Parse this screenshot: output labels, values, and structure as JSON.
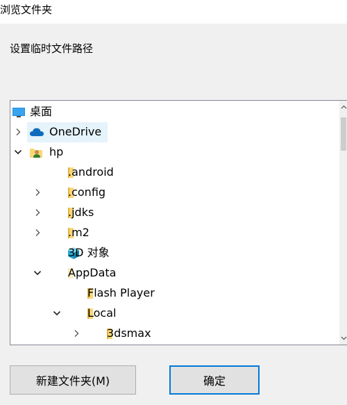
{
  "window": {
    "title": "浏览文件夹"
  },
  "instruction": "设置临时文件路径",
  "tree": {
    "items": [
      {
        "label": "桌面",
        "icon": "desktop-icon",
        "toggle": "none",
        "level": 0
      },
      {
        "label": "OneDrive",
        "icon": "cloud-icon",
        "toggle": "collapsed",
        "level": 0,
        "hover": true
      },
      {
        "label": "hp",
        "icon": "user-folder-icon",
        "toggle": "expanded",
        "level": 0
      },
      {
        "label": ".android",
        "icon": "folder-icon",
        "toggle": "none",
        "level": 1
      },
      {
        "label": ".config",
        "icon": "folder-icon",
        "toggle": "collapsed",
        "level": 1
      },
      {
        "label": ".jdks",
        "icon": "folder-icon",
        "toggle": "collapsed",
        "level": 1
      },
      {
        "label": ".m2",
        "icon": "folder-icon",
        "toggle": "collapsed",
        "level": 1
      },
      {
        "label": "3D 对象",
        "icon": "3d-objects-icon",
        "toggle": "none",
        "level": 1
      },
      {
        "label": "AppData",
        "icon": "folder-light-icon",
        "toggle": "expanded",
        "level": 1
      },
      {
        "label": "Flash Player",
        "icon": "folder-icon",
        "toggle": "none",
        "level": 2
      },
      {
        "label": "Local",
        "icon": "folder-icon",
        "toggle": "expanded",
        "level": 2
      },
      {
        "label": "3dsmax",
        "icon": "folder-icon",
        "toggle": "collapsed",
        "level": 3
      }
    ]
  },
  "buttons": {
    "new_folder": "新建文件夹(M)",
    "ok": "确定"
  },
  "colors": {
    "hover": "#e5f3fb",
    "focus_border": "#0078d7",
    "folder": "#f8d775",
    "folder_dark": "#e2b33f",
    "cloud": "#0f6cbd",
    "desktop": "#1e90e6"
  }
}
